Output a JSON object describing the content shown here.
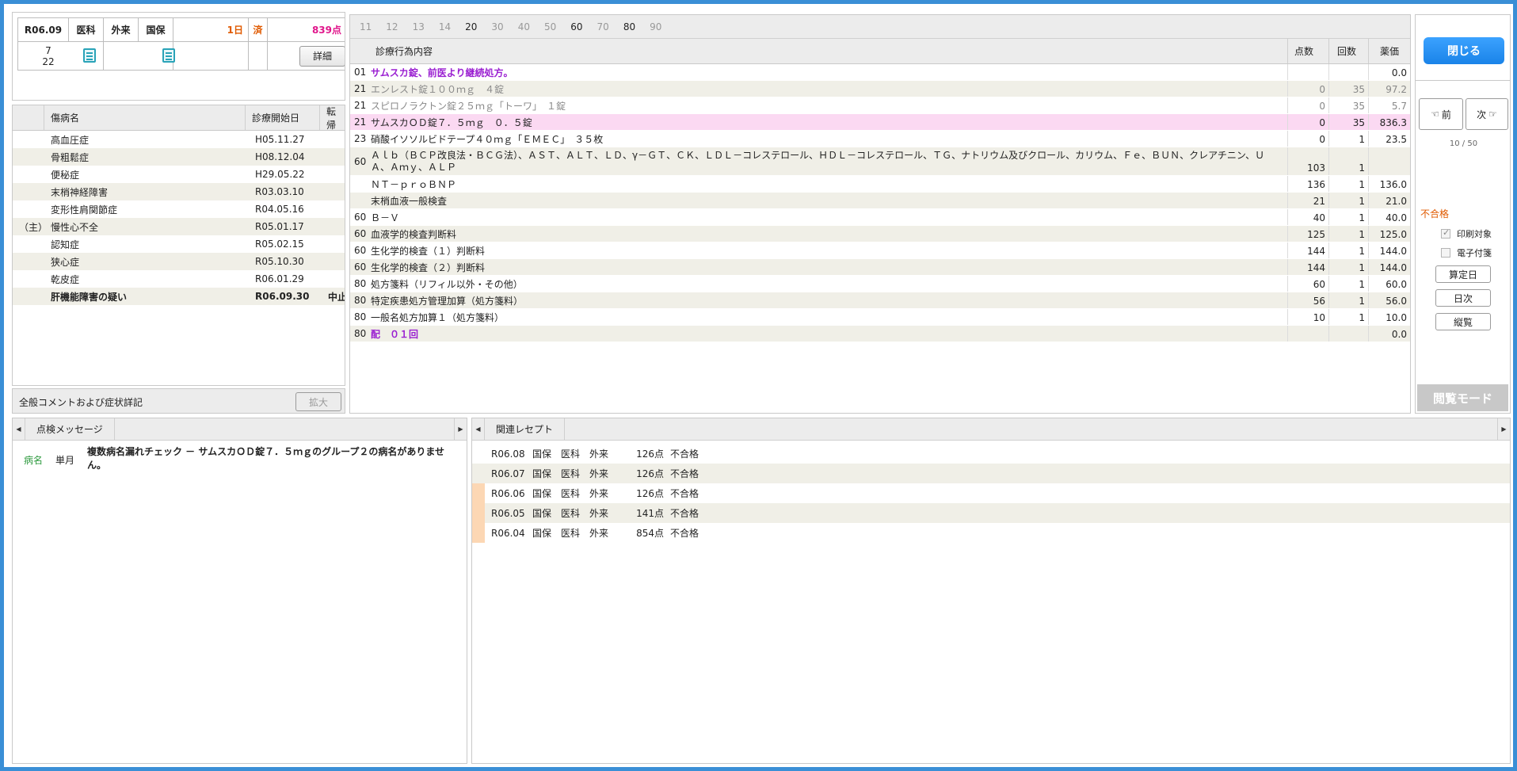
{
  "header": {
    "date": "R06.09",
    "dept": "医科",
    "visit_type": "外来",
    "insurance": "国保",
    "days": "1日",
    "status": "済",
    "points": "839点",
    "day_list": "7\n22",
    "detail_button": "詳細"
  },
  "diseases": {
    "columns": {
      "name": "傷病名",
      "start": "診療開始日",
      "outcome": "転帰"
    },
    "rows": [
      {
        "mark": "",
        "name": "高血圧症",
        "start": "H05.11.27",
        "outcome": "",
        "bold": false
      },
      {
        "mark": "",
        "name": "骨粗鬆症",
        "start": "H08.12.04",
        "outcome": "",
        "bold": false
      },
      {
        "mark": "",
        "name": "便秘症",
        "start": "H29.05.22",
        "outcome": "",
        "bold": false
      },
      {
        "mark": "",
        "name": "末梢神経障害",
        "start": "R03.03.10",
        "outcome": "",
        "bold": false
      },
      {
        "mark": "",
        "name": "変形性肩関節症",
        "start": "R04.05.16",
        "outcome": "",
        "bold": false
      },
      {
        "mark": "（主）",
        "name": "慢性心不全",
        "start": "R05.01.17",
        "outcome": "",
        "bold": false
      },
      {
        "mark": "",
        "name": "認知症",
        "start": "R05.02.15",
        "outcome": "",
        "bold": false
      },
      {
        "mark": "",
        "name": "狭心症",
        "start": "R05.10.30",
        "outcome": "",
        "bold": false
      },
      {
        "mark": "",
        "name": "乾皮症",
        "start": "R06.01.29",
        "outcome": "",
        "bold": false
      },
      {
        "mark": "",
        "name": "肝機能障害の疑い",
        "start": "R06.09.30",
        "outcome": "中止",
        "bold": true
      }
    ]
  },
  "comment": {
    "label": "全般コメントおよび症状詳記",
    "expand_button": "拡大"
  },
  "procedures": {
    "tabs": [
      "11",
      "12",
      "13",
      "14",
      "20",
      "30",
      "40",
      "50",
      "60",
      "70",
      "80",
      "90"
    ],
    "active_tabs": [
      "20",
      "60",
      "80"
    ],
    "columns": {
      "content": "診療行為内容",
      "points": "点数",
      "count": "回数",
      "price": "薬価"
    },
    "rows": [
      {
        "code": "01",
        "content": "サムスカ錠、前医より継続処方。",
        "points": "",
        "count": "",
        "price": "0.0",
        "style": "purple",
        "hl": false
      },
      {
        "code": "21",
        "content": "エンレスト錠１００ｍｇ　４錠",
        "points": "0",
        "count": "35",
        "price": "97.2",
        "style": "gray",
        "hl": false
      },
      {
        "code": "21",
        "content": "スピロノラクトン錠２５ｍｇ「トーワ」　１錠",
        "points": "0",
        "count": "35",
        "price": "5.7",
        "style": "gray",
        "hl": false
      },
      {
        "code": "21",
        "content": "サムスカＯＤ錠７．５ｍｇ　０．５錠",
        "points": "0",
        "count": "35",
        "price": "836.3",
        "style": "",
        "hl": true
      },
      {
        "code": "23",
        "content": "硝酸イソソルビドテープ４０ｍｇ「ＥＭＥＣ」　３５枚",
        "points": "0",
        "count": "1",
        "price": "23.5",
        "style": "",
        "hl": false
      },
      {
        "code": "60",
        "content": "Ａｌｂ（ＢＣＰ改良法・ＢＣＧ法）、ＡＳＴ、ＡＬＴ、ＬＤ、γ－ＧＴ、ＣＫ、ＬＤＬ－コレステロール、ＨＤＬ－コレステロール、ＴＧ、ナトリウム及びクロール、カリウム、Ｆｅ、ＢＵＮ、クレアチニン、ＵＡ、Ａｍｙ、ＡＬＰ",
        "points": "103",
        "count": "1",
        "price": "",
        "style": "",
        "hl": false,
        "tall": true
      },
      {
        "code": "",
        "content": "ＮＴ－ｐｒｏＢＮＰ",
        "points": "136",
        "count": "1",
        "price": "136.0",
        "style": "",
        "hl": false
      },
      {
        "code": "",
        "content": "末梢血液一般検査",
        "points": "21",
        "count": "1",
        "price": "21.0",
        "style": "",
        "hl": false
      },
      {
        "code": "60",
        "content": "Ｂ－Ｖ",
        "points": "40",
        "count": "1",
        "price": "40.0",
        "style": "",
        "hl": false
      },
      {
        "code": "60",
        "content": "血液学的検査判断料",
        "points": "125",
        "count": "1",
        "price": "125.0",
        "style": "",
        "hl": false
      },
      {
        "code": "60",
        "content": "生化学的検査（１）判断料",
        "points": "144",
        "count": "1",
        "price": "144.0",
        "style": "",
        "hl": false
      },
      {
        "code": "60",
        "content": "生化学的検査（２）判断料",
        "points": "144",
        "count": "1",
        "price": "144.0",
        "style": "",
        "hl": false
      },
      {
        "code": "80",
        "content": "処方箋料（リフィル以外・その他）",
        "points": "60",
        "count": "1",
        "price": "60.0",
        "style": "",
        "hl": false
      },
      {
        "code": "80",
        "content": "特定疾患処方管理加算（処方箋料）",
        "points": "56",
        "count": "1",
        "price": "56.0",
        "style": "",
        "hl": false
      },
      {
        "code": "80",
        "content": "一般名処方加算１（処方箋料）",
        "points": "10",
        "count": "1",
        "price": "10.0",
        "style": "",
        "hl": false
      },
      {
        "code": "80",
        "content": "配　０１回",
        "points": "",
        "count": "",
        "price": "0.0",
        "style": "purple",
        "hl": false
      }
    ]
  },
  "sidebar": {
    "close_button": "閉じる",
    "prev_button": "前",
    "next_button": "次",
    "page_counter": "10 / 50",
    "result": "不合格",
    "print_target": "印刷対象",
    "e_attach": "電子付箋",
    "calc_date_button": "算定日",
    "daily_button": "日次",
    "vertical_button": "縦覧",
    "mode_label": "閲覧モード"
  },
  "check_messages": {
    "tab": "点検メッセージ",
    "rows": [
      {
        "category": "病名",
        "period": "単月",
        "message": "複数病名漏れチェック － サムスカＯＤ錠７．５ｍｇのグループ２の病名がありません。"
      }
    ]
  },
  "related": {
    "tab": "関連レセプト",
    "rows": [
      {
        "date": "R06.08",
        "ins": "国保",
        "dept": "医科",
        "visit": "外来",
        "points": "126点",
        "result": "不合格",
        "marker": false
      },
      {
        "date": "R06.07",
        "ins": "国保",
        "dept": "医科",
        "visit": "外来",
        "points": "126点",
        "result": "不合格",
        "marker": false
      },
      {
        "date": "R06.06",
        "ins": "国保",
        "dept": "医科",
        "visit": "外来",
        "points": "126点",
        "result": "不合格",
        "marker": true
      },
      {
        "date": "R06.05",
        "ins": "国保",
        "dept": "医科",
        "visit": "外来",
        "points": "141点",
        "result": "不合格",
        "marker": true
      },
      {
        "date": "R06.04",
        "ins": "国保",
        "dept": "医科",
        "visit": "外来",
        "points": "854点",
        "result": "不合格",
        "marker": true
      }
    ]
  },
  "colors": {
    "frame": "#3a8fd6",
    "accent_blue": "#1a83e8",
    "pink_highlight": "#fbd9f2",
    "purple": "#9a1fd1",
    "orange": "#e05a00",
    "stripe": "#f0efe7"
  }
}
